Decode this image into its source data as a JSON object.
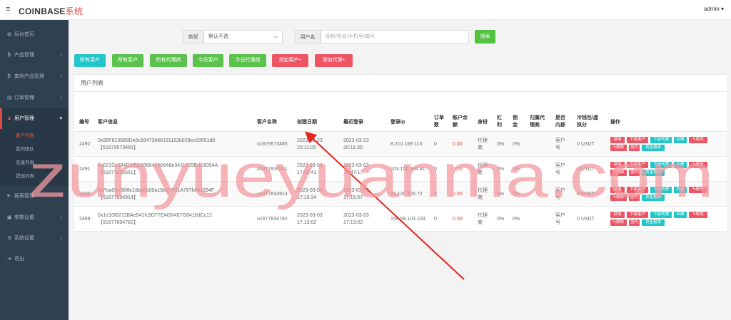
{
  "topbar": {
    "menu_icon": "≡",
    "brand": "COINBASE",
    "brand_suffix": "系统",
    "admin": "admin ▾"
  },
  "sidebar": {
    "items": [
      {
        "label": "后台首页",
        "icon": "dashboard-icon",
        "glyph": "◍"
      },
      {
        "label": "产品管理",
        "icon": "bitcoin-icon",
        "glyph": "₿"
      },
      {
        "label": "套利产品管理",
        "icon": "bitcoin-icon",
        "glyph": "₿"
      },
      {
        "label": "订单管理",
        "icon": "document-icon",
        "glyph": "▤"
      },
      {
        "label": "用户管理",
        "icon": "users-icon",
        "glyph": "♟"
      },
      {
        "label": "报表管理",
        "icon": "yen-icon",
        "glyph": "¥"
      },
      {
        "label": "参数设置",
        "icon": "cube-icon",
        "glyph": "▣"
      },
      {
        "label": "系统设置",
        "icon": "gears-icon",
        "glyph": "⚙"
      },
      {
        "label": "退出",
        "icon": "signout-icon",
        "glyph": "➜"
      }
    ],
    "subitems": [
      "客户列表",
      "我的团队",
      "充值列表",
      "提现列表"
    ]
  },
  "filters": {
    "type_label": "类型",
    "type_value": "默认不选",
    "username_label": "用户名",
    "username_placeholder": "昵称/姓名/手机号/编号",
    "search_button": "搜索"
  },
  "tab_buttons": [
    "所有用户",
    "所有客户",
    "所有代理商",
    "今日客户",
    "今日代理商",
    "添加客户+",
    "添加代理+"
  ],
  "panel": {
    "title": "用户列表",
    "headers": [
      "编号",
      "客户信息",
      "客户名称",
      "创建日期",
      "最近登录",
      "登录ip",
      "订单数",
      "账户余额",
      "身份",
      "杠利",
      "佣金",
      "归属代理商",
      "是否内部",
      "冷钱包/虚拟分",
      "操作"
    ],
    "header_lines": [
      [
        "编号"
      ],
      [
        "客户信息"
      ],
      [
        "客户名称"
      ],
      [
        "创建日期"
      ],
      [
        "最近登录"
      ],
      [
        "登录ip"
      ],
      [
        "订单",
        "数"
      ],
      [
        "账户余",
        "额"
      ],
      [
        "身份"
      ],
      [
        "杠",
        "利"
      ],
      [
        "佣",
        "金"
      ],
      [
        "归属代",
        "理商"
      ],
      [
        "是否",
        "内部"
      ],
      [
        "冷钱包/虚",
        "拟分"
      ],
      [
        "操作"
      ]
    ],
    "rows": [
      {
        "id": "2492",
        "info1": "0x95F8135B9De0c6647366819116​2b028ec09551d9",
        "info2": "【61679573465】",
        "name": "u1679573465",
        "created1": "2023-03-23",
        "created2": "20:11:05",
        "login1": "2023-03-23",
        "login2": "20:11:30",
        "ip": "8.210.169.113",
        "orders": "0",
        "balance": "0.00",
        "role1": "代理",
        "role2": "商",
        "lever": "0%",
        "comm": "0%",
        "agent": "",
        "internal1": "客户",
        "internal2": "号",
        "wallet": "0 USDT"
      },
      {
        "id": "2491",
        "info1": "0x021Cc684C0fBD366043906A6e3411F29Ed53D54A",
        "info2": "【61677836561】",
        "name": "u1677836561",
        "created1": "2023-03-03",
        "created2": "17:42:41",
        "login1": "2023-03-03",
        "login2": "18:47:17",
        "ip": "103.156.184.41",
        "orders": "0",
        "balance": "0.00",
        "role1": "代理",
        "role2": "商",
        "lever": "0%",
        "comm": "0%",
        "agent": "",
        "internal1": "客户",
        "internal2": "号",
        "wallet": "0 USDT"
      },
      {
        "id": "2490",
        "info1": "0xFea06e36f8c19bd0b00a19efA70f1A797fd4f1394F",
        "info2": "【61677834914】",
        "name": "u1677834914",
        "created1": "2023-03-03",
        "created2": "17:15:34",
        "login1": "2023-03-03",
        "login2": "17:15:57",
        "ip": "61.120.155.72",
        "orders": "0",
        "balance": "0.00",
        "role1": "代理",
        "role2": "商",
        "lever": "0%",
        "comm": "0%",
        "agent": "",
        "internal1": "客户",
        "internal2": "号",
        "wallet": "0 USDT"
      },
      {
        "id": "2489",
        "info1": "0x1e10f6272BAe541fc9D77EA03f457f36410dCc12",
        "info2": "【91677834782】",
        "name": "u1677834782",
        "created1": "2023-03-03",
        "created2": "17:13:02",
        "login1": "2023-03-03",
        "login2": "17:13:02",
        "ip": "156.59.103.103",
        "orders": "0",
        "balance": "0.00",
        "role1": "代理",
        "role2": "商",
        "lever": "0%",
        "comm": "0%",
        "agent": "",
        "internal1": "客户",
        "internal2": "号",
        "wallet": "0 USDT"
      }
    ],
    "actions_row1": [
      "禁用",
      "下级客户",
      "下级代理",
      "业绩",
      "✎修改"
    ],
    "actions_row2": [
      "✎删除",
      "签约",
      "资金报表"
    ]
  },
  "watermark": "zunyueyuanma.com",
  "colors": {
    "sidebar": "#2f4050",
    "accent_red": "#ed5565",
    "teal": "#23c6c8",
    "green": "#5cc24e",
    "arrow": "#e8231c",
    "watermark": "#f29aa0"
  }
}
